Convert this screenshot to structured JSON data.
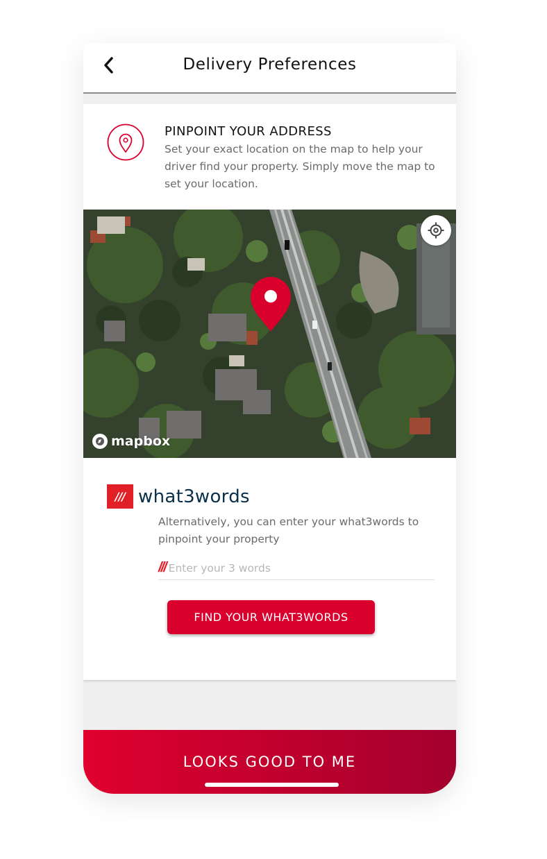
{
  "header": {
    "title": "Delivery Preferences",
    "back_icon": "chevron-left-icon"
  },
  "pinpoint": {
    "icon": "location-pin-icon",
    "title": "PINPOINT YOUR ADDRESS",
    "description": "Set your exact location on the map to help your driver find your property. Simply move the map to set your location."
  },
  "map": {
    "locate_icon": "crosshair-icon",
    "marker_icon": "map-marker-icon",
    "attribution": "mapbox",
    "marker_color": "#d9002e"
  },
  "what3words": {
    "logo_slashes": "///",
    "logo_word": "what3words",
    "description": "Alternatively, you can enter your what3words to pinpoint your property",
    "input_prefix": "///",
    "input_placeholder": "Enter your 3 words",
    "input_value": "",
    "button_label": "FIND YOUR WHAT3WORDS"
  },
  "footer": {
    "cta_label": "LOOKS GOOD TO ME"
  },
  "colors": {
    "brand_red": "#d9002e",
    "w3w_red": "#e11f26",
    "w3w_navy": "#0a3049"
  }
}
